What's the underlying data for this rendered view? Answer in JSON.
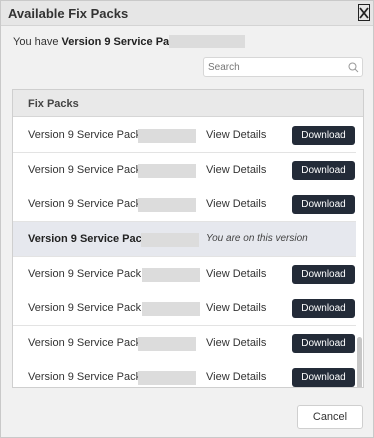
{
  "dialog": {
    "title": "Available Fix Packs",
    "close_icon": "close-icon"
  },
  "version_info": {
    "prefix": "You have",
    "version": "Version 9 Service Pack"
  },
  "search": {
    "placeholder": "Search",
    "value": "",
    "icon": "search-icon"
  },
  "table": {
    "header": "Fix Packs",
    "rows": [
      {
        "name": "Version 9 Service Pack",
        "details": "View Details",
        "action": "Download",
        "current": false
      },
      {
        "name": "Version 9 Service Pack",
        "details": "View Details",
        "action": "Download",
        "current": false
      },
      {
        "name": "Version 9 Service Pack",
        "details": "View Details",
        "action": "Download",
        "current": false
      },
      {
        "name": "Version 9 Service Pack",
        "details": "You are on this version",
        "action": "",
        "current": true
      },
      {
        "name": "Version 9 Service Pack",
        "details": "View Details",
        "action": "Download",
        "current": false
      },
      {
        "name": "Version 9 Service Pack",
        "details": "View Details",
        "action": "Download",
        "current": false
      },
      {
        "name": "Version 9 Service Pack",
        "details": "View Details",
        "action": "Download",
        "current": false
      },
      {
        "name": "Version 9 Service Pack",
        "details": "View Details",
        "action": "Download",
        "current": false
      }
    ]
  },
  "footer": {
    "cancel_label": "Cancel"
  },
  "colors": {
    "download_button_bg": "#232b38",
    "current_row_bg": "#e6e8ee",
    "header_bg": "#e9e9e9"
  }
}
